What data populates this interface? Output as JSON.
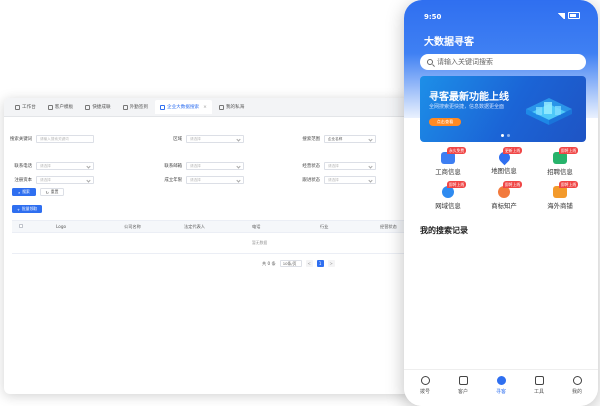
{
  "desktop": {
    "tabs": [
      {
        "label": "工作台"
      },
      {
        "label": "客户模板"
      },
      {
        "label": "快捷成联"
      },
      {
        "label": "外勤签到"
      },
      {
        "label": "企业大数据搜索"
      },
      {
        "label": "我的私海"
      }
    ],
    "form": {
      "keyword_label": "搜索关键词",
      "keyword_placeholder": "请输入搜索关键词",
      "region_label": "区域",
      "region_placeholder": "请选择",
      "scope_label": "搜索范围",
      "scope_value": "企业名称",
      "phone_label": "联系电话",
      "phone_placeholder": "请选择",
      "email_label": "联系邮箱",
      "email_placeholder": "请选择",
      "status_label": "经营状态",
      "status_placeholder": "请选择",
      "capital_label": "注册资本",
      "capital_placeholder": "请选择",
      "established_label": "成立年限",
      "established_placeholder": "请选择",
      "clue_label": "跟进状态",
      "clue_placeholder": "请选择"
    },
    "buttons": {
      "search": "搜索",
      "reset": "重置",
      "batch": "批量领取"
    },
    "table": {
      "columns": [
        "Logo",
        "公司名称",
        "法定代表人",
        "电话",
        "行业",
        "经营状态"
      ],
      "empty": "暂无数据"
    },
    "pager": {
      "total": "共 0 条",
      "page_size": "10条/页",
      "prev": "<",
      "current": "1",
      "next": ">"
    }
  },
  "phone": {
    "time": "9:50",
    "title": "大数据寻客",
    "search_placeholder": "请输入关键词搜索",
    "banner": {
      "title": "寻客最新功能上线",
      "subtitle": "全网搜索更快捷，信息数据更全面",
      "button": "点击查看"
    },
    "features": [
      {
        "label": "工商信息",
        "badge": "永久免费",
        "color": "#3d7ef2"
      },
      {
        "label": "地图信息",
        "badge": "更新上线",
        "color": "#2f6ff0"
      },
      {
        "label": "招聘信息",
        "badge": "即将上线",
        "color": "#27b36b"
      },
      {
        "label": "网域信息",
        "badge": "即将上线",
        "color": "#2f8bf0"
      },
      {
        "label": "商标知产",
        "badge": "即将上线",
        "color": "#f27a3d"
      },
      {
        "label": "海外商铺",
        "badge": "即将上线",
        "color": "#f39a2b"
      }
    ],
    "section_title": "我的搜索记录",
    "nav": [
      {
        "label": "拨号"
      },
      {
        "label": "客户"
      },
      {
        "label": "寻客"
      },
      {
        "label": "工具"
      },
      {
        "label": "我的"
      }
    ]
  }
}
